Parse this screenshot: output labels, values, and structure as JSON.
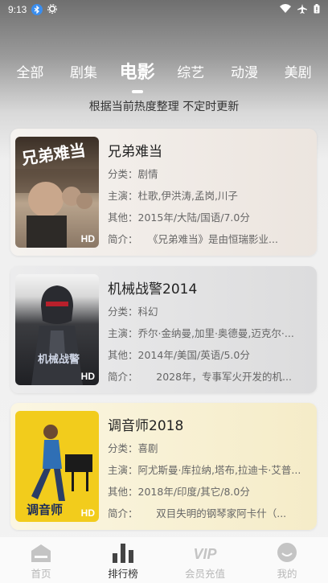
{
  "status_bar": {
    "time": "9:13"
  },
  "tabs": [
    {
      "label": "全部",
      "active": false
    },
    {
      "label": "剧集",
      "active": false
    },
    {
      "label": "电影",
      "active": true
    },
    {
      "label": "综艺",
      "active": false
    },
    {
      "label": "动漫",
      "active": false
    },
    {
      "label": "美剧",
      "active": false
    }
  ],
  "subtitle": "根据当前热度整理 不定时更新",
  "labels": {
    "genre": "分类：",
    "cast": "主演：",
    "other": "其他：",
    "intro": "简介："
  },
  "movies": [
    {
      "title": "兄弟难当",
      "genre": "剧情",
      "cast": "杜歌,伊洪涛,孟岗,川子",
      "other": "2015年/大陆/国语/7.0分",
      "intro": "　　《兄弟难当》是由恒瑞影业...",
      "badge": "HD",
      "poster_text": "兄弟难当",
      "card_color": "#efe9e4"
    },
    {
      "title": "机械战警2014",
      "genre": "科幻",
      "cast": "乔尔·金纳曼,加里·奥德曼,迈克尔·...",
      "other": "2014年/美国/英语/5.0分",
      "intro": "　　 2028年，专事军火开发的机...",
      "badge": "HD",
      "poster_text": "机械战警",
      "card_color": "#e3e3e4"
    },
    {
      "title": "调音师2018",
      "genre": "喜剧",
      "cast": "阿尤斯曼·库拉纳,塔布,拉迪卡·艾普...",
      "other": "2018年/印度/其它/8.0分",
      "intro": "　　 双目失明的钢琴家阿卡什（...",
      "badge": "HD",
      "poster_text": "调音师",
      "card_color": "#f8f1d6"
    }
  ],
  "bottom_nav": [
    {
      "label": "首页",
      "icon": "home-icon",
      "active": false
    },
    {
      "label": "排行榜",
      "icon": "ranking-icon",
      "active": true
    },
    {
      "label": "会员充值",
      "icon": "vip-icon",
      "active": false
    },
    {
      "label": "我的",
      "icon": "profile-icon",
      "active": false
    }
  ],
  "nav_vip_glyph": "VIP"
}
